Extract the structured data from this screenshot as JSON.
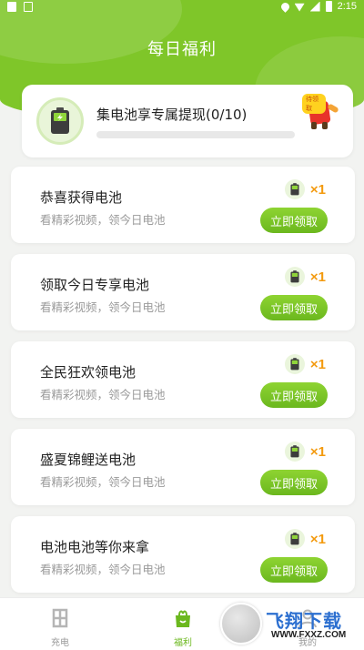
{
  "status_bar": {
    "time": "2:15"
  },
  "header": {
    "title": "每日福利"
  },
  "top_card": {
    "title": "集电池享专属提现(0/10)",
    "progress": 0,
    "badge": "待领取"
  },
  "tasks": [
    {
      "title": "恭喜获得电池",
      "subtitle": "看精彩视频，领今日电池",
      "reward": "×1",
      "button": "立即领取"
    },
    {
      "title": "领取今日专享电池",
      "subtitle": "看精彩视频，领今日电池",
      "reward": "×1",
      "button": "立即领取"
    },
    {
      "title": "全民狂欢领电池",
      "subtitle": "看精彩视频，领今日电池",
      "reward": "×1",
      "button": "立即领取"
    },
    {
      "title": "盛夏锦鲤送电池",
      "subtitle": "看精彩视频，领今日电池",
      "reward": "×1",
      "button": "立即领取"
    },
    {
      "title": "电池电池等你来拿",
      "subtitle": "看精彩视频，领今日电池",
      "reward": "×1",
      "button": "立即领取"
    }
  ],
  "bottom_nav": {
    "items": [
      {
        "label": "充电",
        "icon": "charge-icon",
        "active": false
      },
      {
        "label": "福利",
        "icon": "gift-bag-icon",
        "active": true
      },
      {
        "label": "我的",
        "icon": "profile-icon",
        "active": false
      }
    ]
  },
  "watermark": {
    "text": "飞翔下载",
    "url": "WWW.FXXZ.COM"
  },
  "colors": {
    "brand": "#7fc629",
    "accent": "#f39a0e",
    "button": "#6bb81e"
  }
}
